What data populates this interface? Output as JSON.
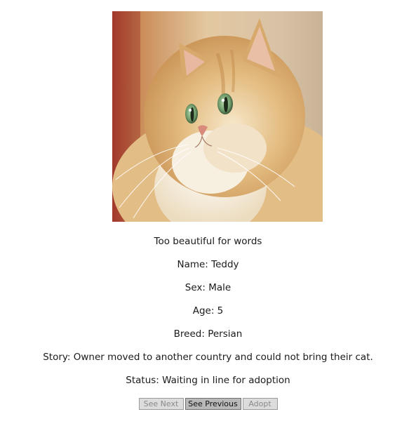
{
  "pet": {
    "photo_alt": "Persian cat",
    "caption": "Too beautiful for words",
    "name_line": "Name: Teddy",
    "sex_line": "Sex: Male",
    "age_line": "Age: 5",
    "breed_line": "Breed: Persian",
    "story_line": "Story: Owner moved to another country and could not bring their cat.",
    "status_line": "Status: Waiting in line for adoption"
  },
  "buttons": {
    "next_label": "See Next",
    "previous_label": "See Previous",
    "adopt_label": "Adopt"
  },
  "colors": {
    "button_disabled_bg": "#dcdcdc",
    "button_active_bg": "#b9b9b9",
    "text": "#1a1a1a"
  }
}
